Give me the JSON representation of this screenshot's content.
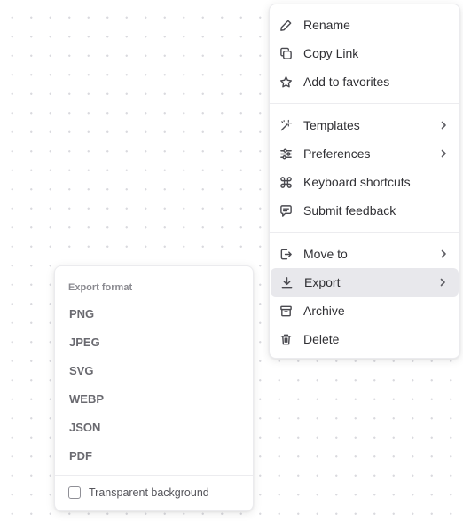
{
  "main_menu": {
    "groups": [
      [
        {
          "label": "Rename",
          "icon": "pencil-icon"
        },
        {
          "label": "Copy Link",
          "icon": "copy-icon"
        },
        {
          "label": "Add to favorites",
          "icon": "star-icon"
        }
      ],
      [
        {
          "label": "Templates",
          "icon": "magic-wand-icon",
          "has_submenu": true
        },
        {
          "label": "Preferences",
          "icon": "sliders-icon",
          "has_submenu": true
        },
        {
          "label": "Keyboard shortcuts",
          "icon": "command-icon"
        },
        {
          "label": "Submit feedback",
          "icon": "speech-bubble-icon"
        }
      ],
      [
        {
          "label": "Move to",
          "icon": "move-arrow-icon",
          "has_submenu": true
        },
        {
          "label": "Export",
          "icon": "download-icon",
          "has_submenu": true,
          "active": true
        },
        {
          "label": "Archive",
          "icon": "archive-box-icon"
        },
        {
          "label": "Delete",
          "icon": "trash-icon"
        }
      ]
    ]
  },
  "export_submenu": {
    "title": "Export format",
    "formats": [
      "PNG",
      "JPEG",
      "SVG",
      "WEBP",
      "JSON",
      "PDF"
    ],
    "transparent_label": "Transparent background",
    "transparent_checked": false
  },
  "colors": {
    "active_item_bg": "#e8e8ec",
    "menu_bg": "#ffffff",
    "canvas_dot": "#d9d9de"
  }
}
